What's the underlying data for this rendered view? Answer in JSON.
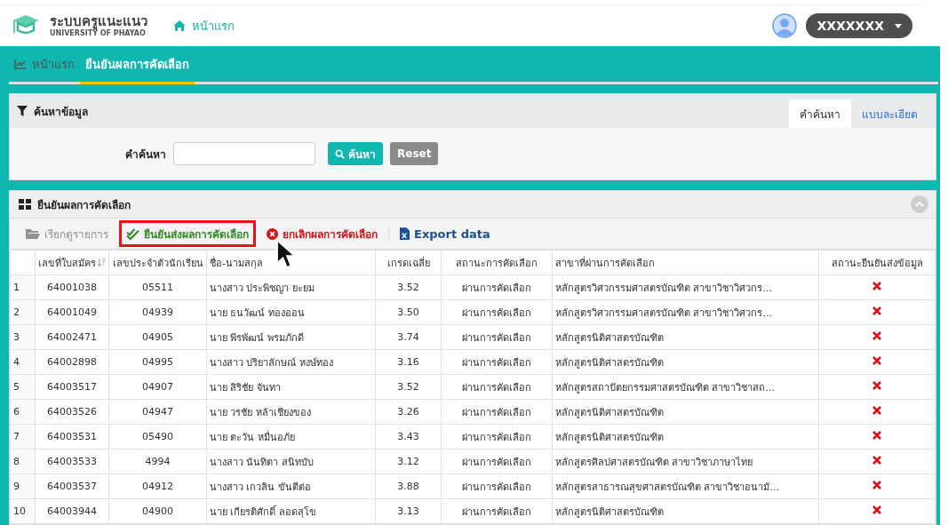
{
  "header": {
    "app_title": "ระบบครูแนะแนว",
    "app_subtitle": "UNIVERSITY OF PHAYAO",
    "home_link": "หน้าแรก",
    "user": "XXXXXXX"
  },
  "breadcrumb": [
    {
      "label": "หน้าแรก",
      "selected": false
    },
    {
      "label": "ยืนยันผลการคัดเลือก",
      "selected": true
    }
  ],
  "search_panel": {
    "title": "ค้นหาข้อมูล",
    "tabs": [
      {
        "label": "คำค้นหา",
        "selected": true
      },
      {
        "label": "แบบละเอียด",
        "selected": false
      }
    ],
    "field_label": "คำค้นหา",
    "search_button": "ค้นหา",
    "reset_button": "Reset"
  },
  "results_panel": {
    "title": "ยืนยันผลการคัดเลือก",
    "actions": [
      {
        "kind": "view",
        "label": "เรียกดูรายการ",
        "disabled": true,
        "highlighted": false
      },
      {
        "kind": "confirm",
        "label": "ยืนยันส่งผลการคัดเลือก",
        "disabled": false,
        "highlighted": true
      },
      {
        "kind": "cancel",
        "label": "ยกเลิกผลการคัดเลือก",
        "disabled": false,
        "highlighted": false
      },
      {
        "kind": "export",
        "label": "Export data",
        "disabled": false,
        "highlighted": false
      }
    ],
    "table": {
      "columns": [
        "เลขที่ใบสมัคร",
        "เลขประจำตัวนักเรียน",
        "ชื่อ-นามสกุล",
        "เกรดเฉลี่ย",
        "สถานะการคัดเลือก",
        "สาขาที่ผ่านการคัดเลือก",
        "สถานะยืนยันส่งข้อมูล"
      ],
      "rows": [
        {
          "index": "1",
          "application_no": "64001038",
          "student_id": "05511",
          "name": "นางสาว ประพิชญา ยะยม",
          "gpa": "3.52",
          "status": "ผ่านการคัดเลือก",
          "program": "หลักสูตรวิศวกรรมศาสตรบัณฑิต สาขาวิชาวิศวกร...",
          "confirmed": false
        },
        {
          "index": "2",
          "application_no": "64001049",
          "student_id": "04939",
          "name": "นาย ธนวัฒน์ ทองออน",
          "gpa": "3.50",
          "status": "ผ่านการคัดเลือก",
          "program": "หลักสูตรวิศวกรรมศาสตรบัณฑิต สาขาวิชาวิศวกร...",
          "confirmed": false
        },
        {
          "index": "3",
          "application_no": "64002471",
          "student_id": "04905",
          "name": "นาย พีรพัฒน์ พรมภักดี",
          "gpa": "3.74",
          "status": "ผ่านการคัดเลือก",
          "program": "หลักสูตรนิติศาสตรบัณฑิต",
          "confirmed": false
        },
        {
          "index": "4",
          "application_no": "64002898",
          "student_id": "04995",
          "name": "นางสาว ปริยาลักษณ์ หงษ์ทอง",
          "gpa": "3.16",
          "status": "ผ่านการคัดเลือก",
          "program": "หลักสูตรนิติศาสตรบัณฑิต",
          "confirmed": false
        },
        {
          "index": "5",
          "application_no": "64003517",
          "student_id": "04907",
          "name": "นาย สิริชัย จันทา",
          "gpa": "3.52",
          "status": "ผ่านการคัดเลือก",
          "program": "หลักสูตรสถาปัตยกรรมศาสตรบัณฑิต สาขาวิชาสถ...",
          "confirmed": false
        },
        {
          "index": "6",
          "application_no": "64003526",
          "student_id": "04947",
          "name": "นาย วรชัย หล้าเชียงของ",
          "gpa": "3.26",
          "status": "ผ่านการคัดเลือก",
          "program": "หลักสูตรนิติศาสตรบัณฑิต",
          "confirmed": false
        },
        {
          "index": "7",
          "application_no": "64003531",
          "student_id": "05490",
          "name": "นาย ตะวัน หมื่นอภัย",
          "gpa": "3.43",
          "status": "ผ่านการคัดเลือก",
          "program": "หลักสูตรนิติศาสตรบัณฑิต",
          "confirmed": false
        },
        {
          "index": "8",
          "application_no": "64003533",
          "student_id": "4994",
          "name": "นางสาว นันทิตา สนิทบับ",
          "gpa": "3.12",
          "status": "ผ่านการคัดเลือก",
          "program": "หลักสูตรศิลปศาสตรบัณฑิต สาขาวิชาภาษาไทย",
          "confirmed": false
        },
        {
          "index": "9",
          "application_no": "64003537",
          "student_id": "04912",
          "name": "นางสาว เกวลิน ขันตีต่อ",
          "gpa": "3.88",
          "status": "ผ่านการคัดเลือก",
          "program": "หลักสูตรสาธารณสุขศาสตรบัณฑิต สาขาวิชาอนามั...",
          "confirmed": false
        },
        {
          "index": "10",
          "application_no": "64003944",
          "student_id": "04900",
          "name": "นาย เกียรติศักดิ์ ลอดสุโข",
          "gpa": "3.13",
          "status": "ผ่านการคัดเลือก",
          "program": "หลักสูตรนิติศาสตรบัณฑิต",
          "confirmed": false
        }
      ]
    }
  }
}
